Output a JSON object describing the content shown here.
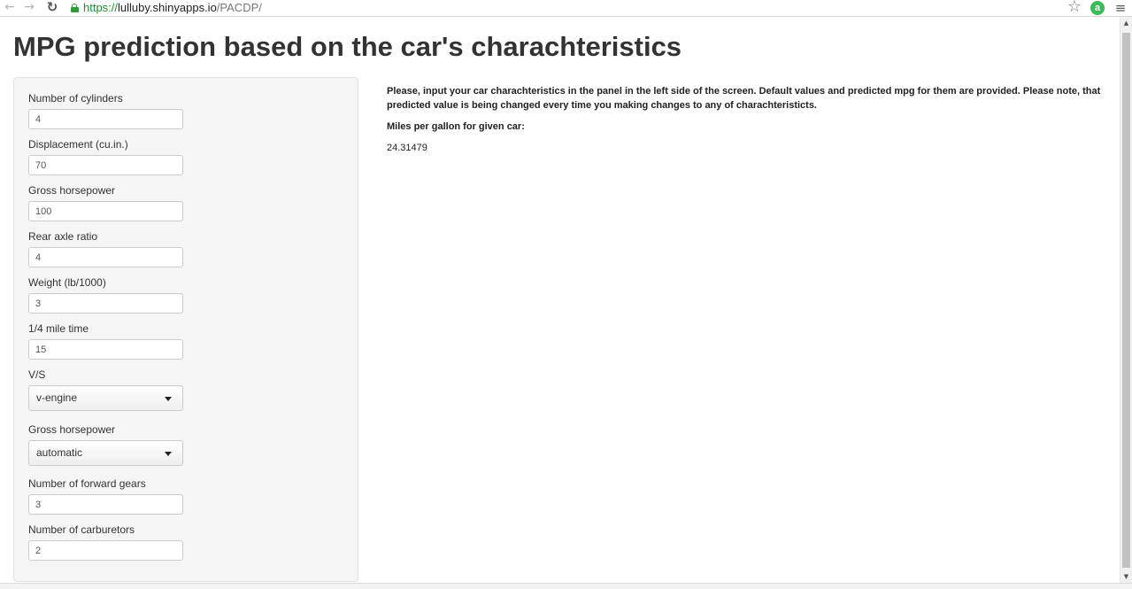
{
  "browser": {
    "url_scheme": "https://",
    "url_host": "lulluby.shinyapps.io",
    "url_path": "/PACDP/",
    "back_icon": "arrow-left-icon",
    "forward_icon": "arrow-right-icon",
    "reload_icon": "reload-icon",
    "star_icon": "star-icon",
    "extension_icon": "extension-icon",
    "menu_icon": "hamburger-menu-icon",
    "accent_secure": "#1e8f33"
  },
  "page": {
    "title": "MPG prediction based on the car's charachteristics"
  },
  "sidebar": {
    "fields": [
      {
        "label": "Number of cylinders",
        "value": "4"
      },
      {
        "label": "Displacement (cu.in.)",
        "value": "70"
      },
      {
        "label": "Gross horsepower",
        "value": "100"
      },
      {
        "label": "Rear axle ratio",
        "value": "4"
      },
      {
        "label": "Weight (lb/1000)",
        "value": "3"
      },
      {
        "label": "1/4 mile time",
        "value": "15"
      }
    ],
    "selects": [
      {
        "label": "V/S",
        "value": "v-engine"
      },
      {
        "label": "Gross horsepower",
        "value": "automatic"
      }
    ],
    "fields_bottom": [
      {
        "label": "Number of forward gears",
        "value": "3"
      },
      {
        "label": "Number of carburetors",
        "value": "2"
      }
    ]
  },
  "main": {
    "intro": "Please, input your car charachteristics in the panel in the left side of the screen. Default values and predicted mpg for them are provided. Please note, that predicted value is being changed every time you making changes to any of charachteristicts.",
    "result_label": "Miles per gallon for given car:",
    "result_value": "24.31479"
  }
}
